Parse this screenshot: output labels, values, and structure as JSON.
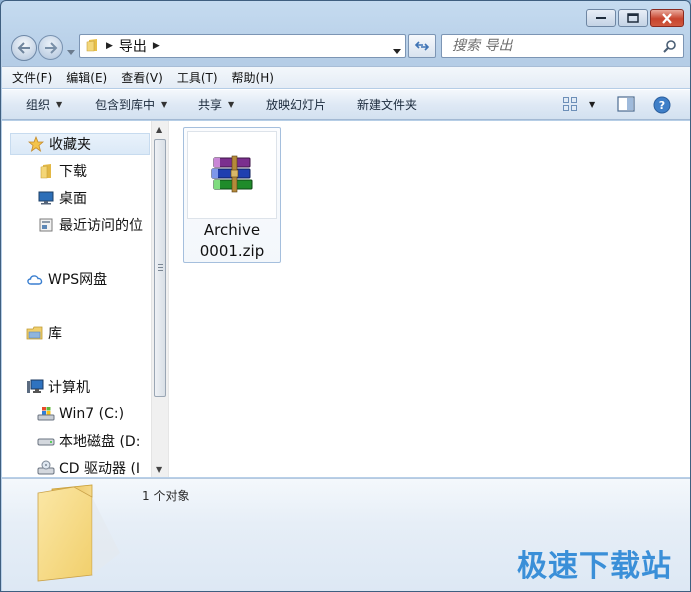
{
  "address_bar": {
    "path": [
      "导出"
    ]
  },
  "search": {
    "placeholder": "搜索 导出"
  },
  "menu": {
    "items": [
      "文件(F)",
      "编辑(E)",
      "查看(V)",
      "工具(T)",
      "帮助(H)"
    ]
  },
  "toolbar": {
    "organize": "组织",
    "include_in_library": "包含到库中",
    "share": "共享",
    "slideshow": "放映幻灯片",
    "new_folder": "新建文件夹"
  },
  "nav_pane": {
    "favorites": "收藏夹",
    "downloads": "下载",
    "desktop": "桌面",
    "recent": "最近访问的位",
    "wps": "WPS网盘",
    "libraries": "库",
    "computer": "计算机",
    "drive_c": "Win7 (C:)",
    "drive_d": "本地磁盘 (D:",
    "drive_cd": "CD 驱动器 (I"
  },
  "files": [
    {
      "name_line1": "Archive",
      "name_line2": "0001.zip",
      "icon": "winrar-archive-icon"
    }
  ],
  "details": {
    "status": "1 个对象"
  },
  "watermark": "极速下载站",
  "colors": {
    "accent": "#3a8fd8",
    "frame": "#b9d1ea"
  }
}
